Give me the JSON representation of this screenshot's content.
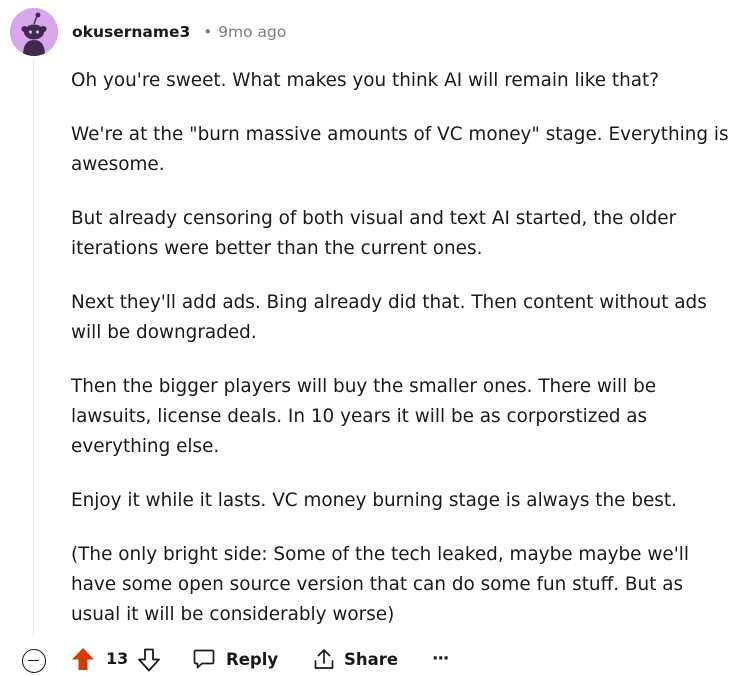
{
  "comment": {
    "author": "okusername3",
    "separator": "•",
    "age": "9mo ago",
    "paragraphs": [
      "Oh you're sweet. What makes you think AI will remain like that?",
      "We're at the \"burn massive amounts of VC money\" stage. Everything is awesome.",
      "But already censoring of both visual and text AI started, the older iterations were better than the current ones.",
      "Next they'll add ads. Bing already did that. Then content without ads will be downgraded.",
      "Then the bigger players will buy the smaller ones. There will be lawsuits, license deals. In 10 years it will be as corporstized as everything else.",
      "Enjoy it while it lasts. VC money burning stage is always the best.",
      "(The only bright side: Some of the tech leaked, maybe maybe we'll have some open source version that can do some fun stuff. But as usual it will be considerably worse)"
    ]
  },
  "actions": {
    "score": "13",
    "reply_label": "Reply",
    "share_label": "Share",
    "more_label": "···"
  },
  "icons": {
    "avatar": "snoo-avatar",
    "collapse": "collapse-minus-icon",
    "upvote": "upvote-arrow-icon",
    "downvote": "downvote-arrow-icon",
    "reply": "speech-bubble-icon",
    "share": "share-upload-icon",
    "more": "overflow-dots-icon"
  },
  "colors": {
    "avatar_bg": "#d7a6ec",
    "upvote_active": "#d93a00",
    "meta_gray": "#7c7c7c",
    "text": "#1a1a1b"
  }
}
